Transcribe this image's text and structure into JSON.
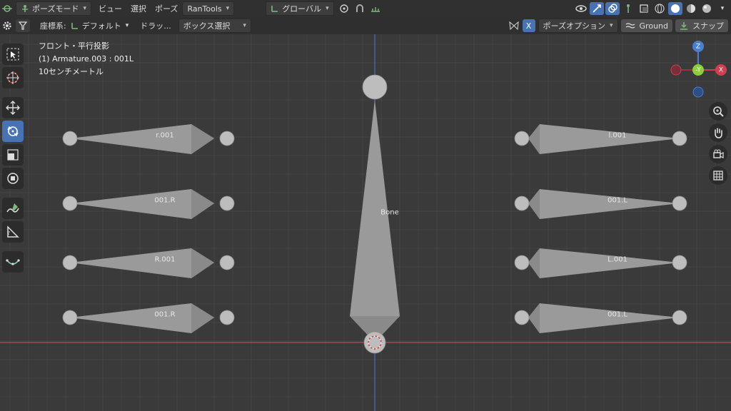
{
  "header": {
    "mode_label": "ポーズモード",
    "menus": [
      "ビュー",
      "選択",
      "ポーズ"
    ],
    "addon_label": "RanTools",
    "transform_orientation": "グローバル"
  },
  "toolbar": {
    "coord_label": "座標系:",
    "coord_value": "デフォルト",
    "drag_label": "ドラッ...",
    "select_mode": "ボックス選択",
    "x_mirror": "X",
    "pose_options": "ポーズオプション",
    "ground_label": "Ground",
    "snap_label": "スナップ"
  },
  "viewport": {
    "view_name": "フロント・平行投影",
    "object_info": "(1) Armature.003 : 001L",
    "scale_info": "10センチメートル"
  },
  "gizmo": {
    "z": "Z",
    "y": "-Y",
    "x": "X"
  },
  "bones": {
    "left": [
      "r.001",
      "001.R",
      "R.001",
      "001.R"
    ],
    "right": [
      "l.001",
      "001.L",
      "L.001",
      "001.L"
    ],
    "center": "Bone"
  },
  "colors": {
    "accent": "#4772b3",
    "bone": "#9a9a9a",
    "grid_bg": "#3a3a3a",
    "x_axis": "#b04a5a",
    "z_axis": "#4a6eb8"
  },
  "icons": {
    "left_tools": [
      "select-box-icon",
      "cursor-icon",
      "move-icon",
      "rotate-icon",
      "scale-icon",
      "transform-icon",
      "annotate-icon",
      "measure-icon",
      "relax-pose-icon"
    ],
    "right_tools": [
      "zoom-icon",
      "pan-hand-icon",
      "camera-icon",
      "grid-icon"
    ]
  }
}
